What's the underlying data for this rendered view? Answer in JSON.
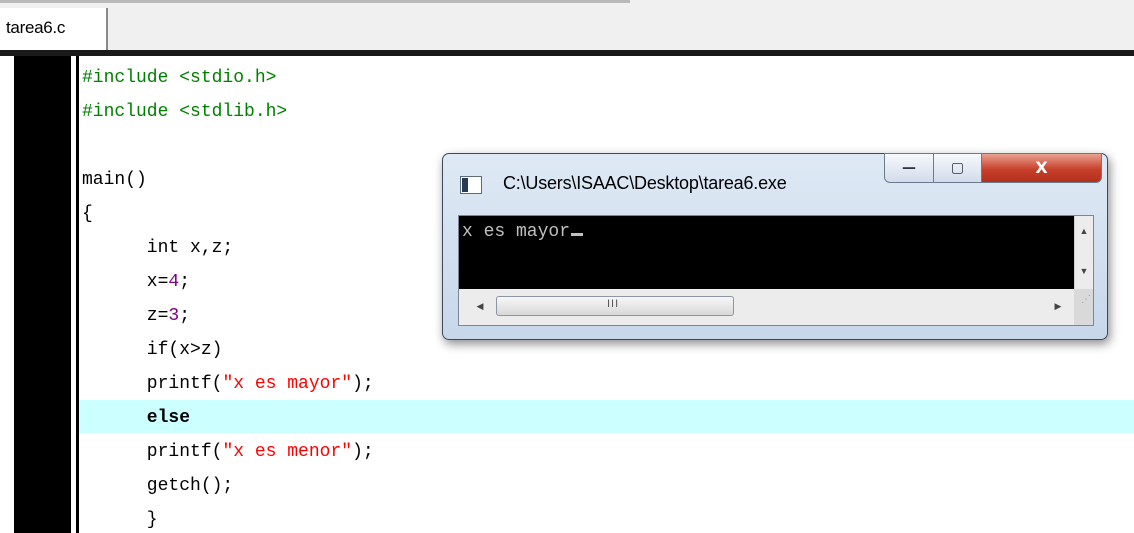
{
  "tabs": [
    {
      "label": "tarea6.c",
      "active": true
    }
  ],
  "editor": {
    "highlight_color": "#ccffff",
    "lines": [
      [
        {
          "t": "#include <stdio.h>",
          "c": "pp"
        }
      ],
      [
        {
          "t": "#include <stdlib.h>",
          "c": "pp"
        }
      ],
      [],
      [
        {
          "t": "main()",
          "c": ""
        }
      ],
      [
        {
          "t": "{",
          "c": ""
        }
      ],
      [
        {
          "t": "      int x,z;",
          "c": ""
        }
      ],
      [
        {
          "t": "      x=",
          "c": ""
        },
        {
          "t": "4",
          "c": "num"
        },
        {
          "t": ";",
          "c": ""
        }
      ],
      [
        {
          "t": "      z=",
          "c": ""
        },
        {
          "t": "3",
          "c": "num"
        },
        {
          "t": ";",
          "c": ""
        }
      ],
      [
        {
          "t": "      if(x>z)",
          "c": ""
        }
      ],
      [
        {
          "t": "      printf(",
          "c": ""
        },
        {
          "t": "\"x es mayor\"",
          "c": "str"
        },
        {
          "t": ");",
          "c": ""
        }
      ],
      [
        {
          "t": "      else",
          "c": "kw"
        }
      ],
      [
        {
          "t": "      printf(",
          "c": ""
        },
        {
          "t": "\"x es menor\"",
          "c": "str"
        },
        {
          "t": ");",
          "c": ""
        }
      ],
      [
        {
          "t": "      getch();",
          "c": ""
        }
      ],
      [
        {
          "t": "      }",
          "c": ""
        }
      ]
    ]
  },
  "console": {
    "title": "C:\\Users\\ISAAC\\Desktop\\tarea6.exe",
    "output": "x es mayor",
    "buttons": {
      "minimize": "—",
      "maximize": "▢",
      "close": "X"
    },
    "hscroll_thumb": "III"
  }
}
